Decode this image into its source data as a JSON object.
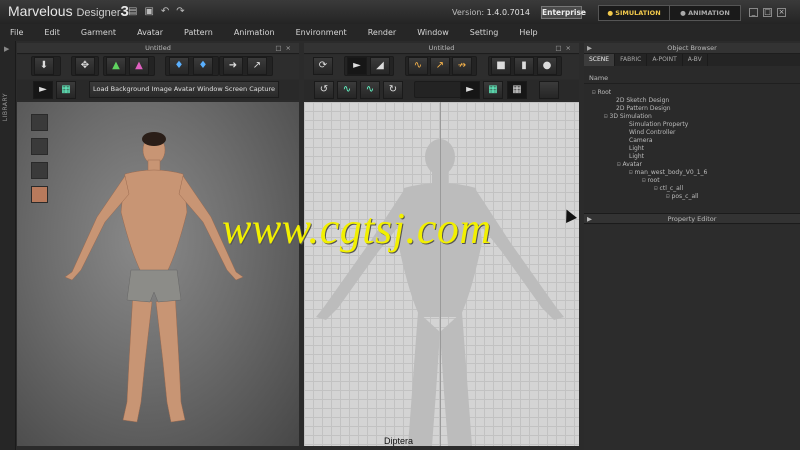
{
  "app": {
    "brand_name": "Marvelous",
    "brand_sub": "Designer",
    "brand_ver": "3",
    "version_label": "Version:",
    "version_value": "1.4.0.7014",
    "edition": "Enterprise",
    "mode_simulation": "SIMULATION",
    "mode_animation": "ANIMATION"
  },
  "menu": [
    "File",
    "Edit",
    "Garment",
    "Avatar",
    "Pattern",
    "Animation",
    "Environment",
    "Render",
    "Window",
    "Setting",
    "Help"
  ],
  "library": {
    "label": "LIBRARY"
  },
  "view3d": {
    "title": "Untitled",
    "subbar_text": "Load Background Image Avatar Window Screen Capture"
  },
  "view2d": {
    "title": "Untitled",
    "footer_label": "Diptera"
  },
  "object_browser": {
    "title": "Object Browser",
    "tabs": [
      "SCENE",
      "FABRIC",
      "A-POINT",
      "A-BV"
    ],
    "name_header": "Name",
    "tree": [
      {
        "label": "Root",
        "toggle": "⊟"
      },
      {
        "label": "2D Sketch Design",
        "toggle": ""
      },
      {
        "label": "2D Pattern Design",
        "toggle": ""
      },
      {
        "label": "3D Simulation",
        "toggle": "⊟"
      },
      {
        "label": "Simulation Property",
        "toggle": ""
      },
      {
        "label": "Wind Controller",
        "toggle": ""
      },
      {
        "label": "Camera",
        "toggle": ""
      },
      {
        "label": "Light",
        "toggle": ""
      },
      {
        "label": "Light",
        "toggle": ""
      },
      {
        "label": "Avatar",
        "toggle": "⊟"
      },
      {
        "label": "man_west_body_V0_1_6",
        "toggle": "⊟"
      },
      {
        "label": "root",
        "toggle": "⊟"
      },
      {
        "label": "ctl_c_all",
        "toggle": "⊟"
      },
      {
        "label": "pos_c_all",
        "toggle": "⊟"
      }
    ]
  },
  "property_editor": {
    "title": "Property Editor"
  },
  "watermark": "www.cgtsj.com"
}
